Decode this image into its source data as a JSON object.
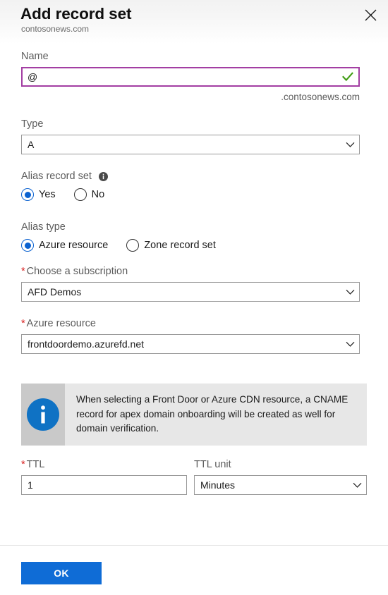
{
  "header": {
    "title": "Add record set",
    "subtitle": "contosonews.com",
    "close_label": "Close"
  },
  "form": {
    "name": {
      "label": "Name",
      "value": "@",
      "placeholder": "",
      "suffix": ".contosonews.com",
      "valid_icon": "checkmark-icon",
      "valid_color": "#3f9c12"
    },
    "type": {
      "label": "Type",
      "value": "A"
    },
    "alias_record_set": {
      "label": "Alias record set",
      "info_icon": "info-icon",
      "options": [
        {
          "label": "Yes",
          "selected": true
        },
        {
          "label": "No",
          "selected": false
        }
      ]
    },
    "alias_type": {
      "label": "Alias type",
      "options": [
        {
          "label": "Azure resource",
          "selected": true
        },
        {
          "label": "Zone record set",
          "selected": false
        }
      ]
    },
    "subscription": {
      "label": "Choose a subscription",
      "required": true,
      "value": "AFD Demos"
    },
    "azure_resource": {
      "label": "Azure resource",
      "required": true,
      "value": "frontdoordemo.azurefd.net"
    },
    "ttl": {
      "label": "TTL",
      "required": true,
      "value": "1"
    },
    "ttl_unit": {
      "label": "TTL unit",
      "value": "Minutes"
    }
  },
  "info_banner": {
    "icon": "info-circle-icon",
    "text": "When selecting a Front Door or Azure CDN resource, a CNAME record for apex domain onboarding will be created as well for domain verification."
  },
  "footer": {
    "ok_label": "OK"
  },
  "colors": {
    "accent_blue": "#0f6cd6",
    "radio_blue": "#0b62d0",
    "focus_purple": "#a33ea3",
    "required_red": "#d72222",
    "success_green": "#3f9c12",
    "info_bg": "#e7e7e7",
    "info_icon_bg": "#c9c9c9"
  }
}
